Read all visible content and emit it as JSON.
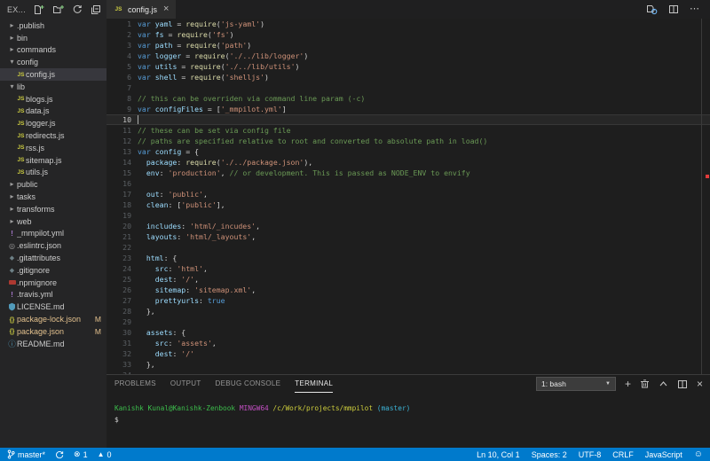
{
  "explorer": {
    "title": "EX...",
    "actions": [
      "new-file-icon",
      "new-folder-icon",
      "refresh-icon",
      "collapse-all-icon"
    ],
    "items": [
      {
        "label": ".publish",
        "icon": "chevron-right-icon",
        "indent": 0
      },
      {
        "label": "bin",
        "icon": "chevron-right-icon",
        "indent": 0
      },
      {
        "label": "commands",
        "icon": "chevron-right-icon",
        "indent": 0
      },
      {
        "label": "config",
        "icon": "chevron-down-icon",
        "indent": 0
      },
      {
        "label": "config.js",
        "icon": "js-file-icon",
        "indent": 1,
        "selected": true
      },
      {
        "label": "lib",
        "icon": "chevron-down-icon",
        "indent": 0
      },
      {
        "label": "blogs.js",
        "icon": "js-file-icon",
        "indent": 1
      },
      {
        "label": "data.js",
        "icon": "js-file-icon",
        "indent": 1
      },
      {
        "label": "logger.js",
        "icon": "js-file-icon",
        "indent": 1
      },
      {
        "label": "redirects.js",
        "icon": "js-file-icon",
        "indent": 1
      },
      {
        "label": "rss.js",
        "icon": "js-file-icon",
        "indent": 1
      },
      {
        "label": "sitemap.js",
        "icon": "js-file-icon",
        "indent": 1
      },
      {
        "label": "utils.js",
        "icon": "js-file-icon",
        "indent": 1
      },
      {
        "label": "public",
        "icon": "chevron-right-icon",
        "indent": 0
      },
      {
        "label": "tasks",
        "icon": "chevron-right-icon",
        "indent": 0
      },
      {
        "label": "transforms",
        "icon": "chevron-right-icon",
        "indent": 0
      },
      {
        "label": "web",
        "icon": "chevron-right-icon",
        "indent": 0
      },
      {
        "label": "_mmpilot.yml",
        "icon": "yml-file-icon",
        "indent": 0
      },
      {
        "label": ".eslintrc.json",
        "icon": "eslint-file-icon",
        "indent": 0
      },
      {
        "label": ".gitattributes",
        "icon": "git-file-icon",
        "indent": 0
      },
      {
        "label": ".gitignore",
        "icon": "git-file-icon",
        "indent": 0
      },
      {
        "label": ".npmignore",
        "icon": "npm-file-icon",
        "indent": 0
      },
      {
        "label": ".travis.yml",
        "icon": "yml-file-icon",
        "indent": 0
      },
      {
        "label": "LICENSE.md",
        "icon": "license-file-icon",
        "indent": 0
      },
      {
        "label": "package-lock.json",
        "icon": "json-file-icon",
        "indent": 0,
        "badge": "M",
        "modified": true
      },
      {
        "label": "package.json",
        "icon": "json-file-icon",
        "indent": 0,
        "badge": "M",
        "modified": true
      },
      {
        "label": "README.md",
        "icon": "info-file-icon",
        "indent": 0
      }
    ]
  },
  "tabbar": {
    "tab": {
      "label": "config.js",
      "icon": "js-file-icon",
      "close_label": "×"
    },
    "actions": [
      "open-changes-icon",
      "split-editor-icon",
      "more-actions-icon"
    ]
  },
  "editor": {
    "current_line": 10,
    "lines": [
      {
        "n": 1,
        "segs": [
          [
            "k",
            "var"
          ],
          [
            "p",
            " "
          ],
          [
            "v",
            "yaml"
          ],
          [
            "p",
            " = "
          ],
          [
            "f",
            "require"
          ],
          [
            "p",
            "("
          ],
          [
            "s",
            "'js-yaml'"
          ],
          [
            "p",
            ")"
          ]
        ]
      },
      {
        "n": 2,
        "segs": [
          [
            "k",
            "var"
          ],
          [
            "p",
            " "
          ],
          [
            "v",
            "fs"
          ],
          [
            "p",
            " = "
          ],
          [
            "f",
            "require"
          ],
          [
            "p",
            "("
          ],
          [
            "s",
            "'fs'"
          ],
          [
            "p",
            ")"
          ]
        ]
      },
      {
        "n": 3,
        "segs": [
          [
            "k",
            "var"
          ],
          [
            "p",
            " "
          ],
          [
            "v",
            "path"
          ],
          [
            "p",
            " = "
          ],
          [
            "f",
            "require"
          ],
          [
            "p",
            "("
          ],
          [
            "s",
            "'path'"
          ],
          [
            "p",
            ")"
          ]
        ]
      },
      {
        "n": 4,
        "segs": [
          [
            "k",
            "var"
          ],
          [
            "p",
            " "
          ],
          [
            "v",
            "logger"
          ],
          [
            "p",
            " = "
          ],
          [
            "f",
            "require"
          ],
          [
            "p",
            "("
          ],
          [
            "s",
            "'./../lib/logger'"
          ],
          [
            "p",
            ")"
          ]
        ]
      },
      {
        "n": 5,
        "segs": [
          [
            "k",
            "var"
          ],
          [
            "p",
            " "
          ],
          [
            "v",
            "utils"
          ],
          [
            "p",
            " = "
          ],
          [
            "f",
            "require"
          ],
          [
            "p",
            "("
          ],
          [
            "s",
            "'./../lib/utils'"
          ],
          [
            "p",
            ")"
          ]
        ]
      },
      {
        "n": 6,
        "segs": [
          [
            "k",
            "var"
          ],
          [
            "p",
            " "
          ],
          [
            "v",
            "shell"
          ],
          [
            "p",
            " = "
          ],
          [
            "f",
            "require"
          ],
          [
            "p",
            "("
          ],
          [
            "s",
            "'shelljs'"
          ],
          [
            "p",
            ")"
          ]
        ]
      },
      {
        "n": 7,
        "segs": []
      },
      {
        "n": 8,
        "segs": [
          [
            "c",
            "// this can be overriden via command line param (-c)"
          ]
        ]
      },
      {
        "n": 9,
        "segs": [
          [
            "k",
            "var"
          ],
          [
            "p",
            " "
          ],
          [
            "v",
            "configFiles"
          ],
          [
            "p",
            " = ["
          ],
          [
            "s",
            "'_mmpilot.yml'"
          ],
          [
            "p",
            "]"
          ]
        ]
      },
      {
        "n": 10,
        "segs": []
      },
      {
        "n": 11,
        "segs": [
          [
            "c",
            "// these can be set via config file"
          ]
        ]
      },
      {
        "n": 12,
        "segs": [
          [
            "c",
            "// paths are specified relative to root and converted to absolute path in load()"
          ]
        ]
      },
      {
        "n": 13,
        "segs": [
          [
            "k",
            "var"
          ],
          [
            "p",
            " "
          ],
          [
            "v",
            "config"
          ],
          [
            "p",
            " = {"
          ]
        ]
      },
      {
        "n": 14,
        "segs": [
          [
            "p",
            "  "
          ],
          [
            "v",
            "package"
          ],
          [
            "p",
            ": "
          ],
          [
            "f",
            "require"
          ],
          [
            "p",
            "("
          ],
          [
            "s",
            "'./../package.json'"
          ],
          [
            "p",
            "),"
          ]
        ]
      },
      {
        "n": 15,
        "segs": [
          [
            "p",
            "  "
          ],
          [
            "v",
            "env"
          ],
          [
            "p",
            ": "
          ],
          [
            "s",
            "'production'"
          ],
          [
            "p",
            ", "
          ],
          [
            "c",
            "// or development. This is passed as NODE_ENV to envify"
          ]
        ]
      },
      {
        "n": 16,
        "segs": []
      },
      {
        "n": 17,
        "segs": [
          [
            "p",
            "  "
          ],
          [
            "v",
            "out"
          ],
          [
            "p",
            ": "
          ],
          [
            "s",
            "'public'"
          ],
          [
            "p",
            ","
          ]
        ]
      },
      {
        "n": 18,
        "segs": [
          [
            "p",
            "  "
          ],
          [
            "v",
            "clean"
          ],
          [
            "p",
            ": ["
          ],
          [
            "s",
            "'public'"
          ],
          [
            "p",
            "],"
          ]
        ]
      },
      {
        "n": 19,
        "segs": []
      },
      {
        "n": 20,
        "segs": [
          [
            "p",
            "  "
          ],
          [
            "v",
            "includes"
          ],
          [
            "p",
            ": "
          ],
          [
            "s",
            "'html/_incudes'"
          ],
          [
            "p",
            ","
          ]
        ]
      },
      {
        "n": 21,
        "segs": [
          [
            "p",
            "  "
          ],
          [
            "v",
            "layouts"
          ],
          [
            "p",
            ": "
          ],
          [
            "s",
            "'html/_layouts'"
          ],
          [
            "p",
            ","
          ]
        ]
      },
      {
        "n": 22,
        "segs": []
      },
      {
        "n": 23,
        "segs": [
          [
            "p",
            "  "
          ],
          [
            "v",
            "html"
          ],
          [
            "p",
            ": {"
          ]
        ]
      },
      {
        "n": 24,
        "segs": [
          [
            "p",
            "    "
          ],
          [
            "v",
            "src"
          ],
          [
            "p",
            ": "
          ],
          [
            "s",
            "'html'"
          ],
          [
            "p",
            ","
          ]
        ]
      },
      {
        "n": 25,
        "segs": [
          [
            "p",
            "    "
          ],
          [
            "v",
            "dest"
          ],
          [
            "p",
            ": "
          ],
          [
            "s",
            "'/'"
          ],
          [
            "p",
            ","
          ]
        ]
      },
      {
        "n": 26,
        "segs": [
          [
            "p",
            "    "
          ],
          [
            "v",
            "sitemap"
          ],
          [
            "p",
            ": "
          ],
          [
            "s",
            "'sitemap.xml'"
          ],
          [
            "p",
            ","
          ]
        ]
      },
      {
        "n": 27,
        "segs": [
          [
            "p",
            "    "
          ],
          [
            "v",
            "prettyurls"
          ],
          [
            "p",
            ": "
          ],
          [
            "k",
            "true"
          ]
        ]
      },
      {
        "n": 28,
        "segs": [
          [
            "p",
            "  },"
          ]
        ]
      },
      {
        "n": 29,
        "segs": []
      },
      {
        "n": 30,
        "segs": [
          [
            "p",
            "  "
          ],
          [
            "v",
            "assets"
          ],
          [
            "p",
            ": {"
          ]
        ]
      },
      {
        "n": 31,
        "segs": [
          [
            "p",
            "    "
          ],
          [
            "v",
            "src"
          ],
          [
            "p",
            ": "
          ],
          [
            "s",
            "'assets'"
          ],
          [
            "p",
            ","
          ]
        ]
      },
      {
        "n": 32,
        "segs": [
          [
            "p",
            "    "
          ],
          [
            "v",
            "dest"
          ],
          [
            "p",
            ": "
          ],
          [
            "s",
            "'/'"
          ]
        ]
      },
      {
        "n": 33,
        "segs": [
          [
            "p",
            "  },"
          ]
        ]
      },
      {
        "n": 34,
        "segs": []
      }
    ]
  },
  "panel": {
    "tabs": [
      {
        "label": "PROBLEMS"
      },
      {
        "label": "OUTPUT"
      },
      {
        "label": "DEBUG CONSOLE"
      },
      {
        "label": "TERMINAL",
        "active": true
      }
    ],
    "shell_select": "1: bash",
    "actions": [
      "new-terminal-icon",
      "kill-terminal-icon",
      "maximize-panel-icon",
      "split-terminal-icon",
      "close-panel-icon"
    ],
    "terminal_lines": [
      {
        "segs": [
          [
            "green",
            "Kanishk Kunal@Kanishk-Zenbook"
          ],
          [
            "plain",
            " "
          ],
          [
            "magenta",
            "MINGW64"
          ],
          [
            "plain",
            " "
          ],
          [
            "yellow",
            "/c/Work/projects/mmpilot"
          ],
          [
            "plain",
            " "
          ],
          [
            "cyan",
            "(master)"
          ]
        ]
      },
      {
        "segs": [
          [
            "plain",
            "$"
          ]
        ]
      }
    ]
  },
  "statusbar": {
    "branch": "master*",
    "errors": "1",
    "warnings": "0",
    "right": [
      "Ln 10, Col 1",
      "Spaces: 2",
      "UTF-8",
      "CRLF",
      "JavaScript"
    ]
  },
  "colors": {
    "statusbar_bg": "#007acc",
    "sidebar_bg": "#252526",
    "editor_bg": "#1e1e1e",
    "selected_item_bg": "#37373d",
    "modified_file": "#e2c08d",
    "error_marker": "#e13b3b",
    "syntax_keyword": "#569cd6",
    "syntax_variable": "#9cdcfe",
    "syntax_function": "#dcdcaa",
    "syntax_string": "#ce9178",
    "syntax_comment": "#6a9955"
  }
}
